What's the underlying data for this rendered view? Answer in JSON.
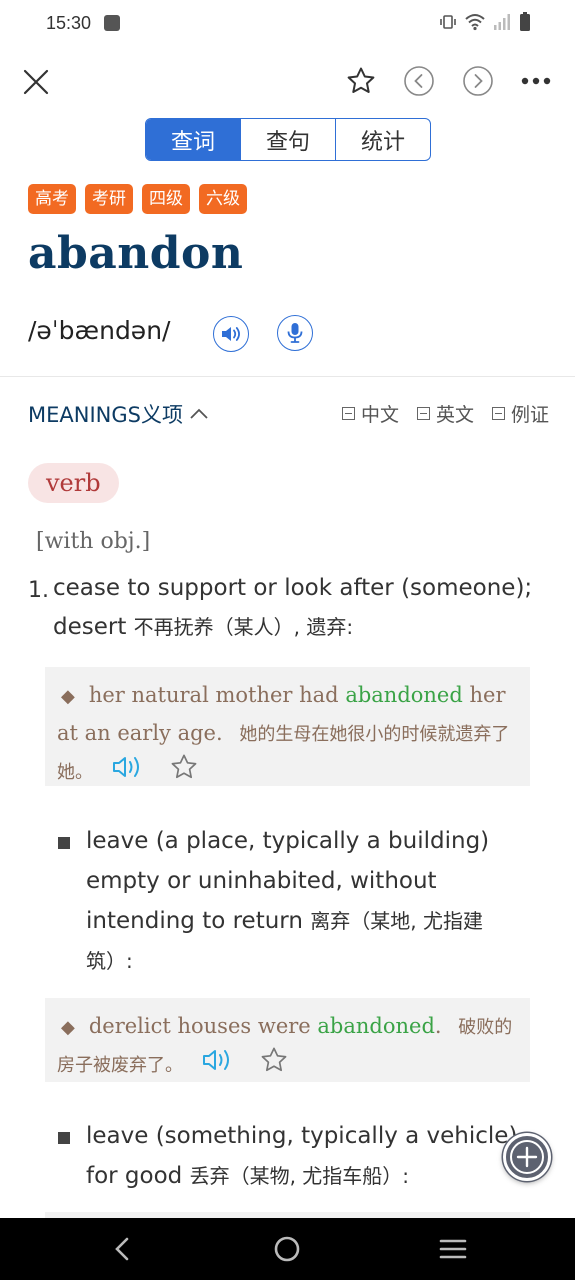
{
  "status_bar": {
    "time": "15:30"
  },
  "tabs": [
    {
      "label": "查词",
      "active": true
    },
    {
      "label": "查句",
      "active": false
    },
    {
      "label": "统计",
      "active": false
    }
  ],
  "tags": [
    "高考",
    "考研",
    "四级",
    "六级"
  ],
  "headword": "abandon",
  "phonetic": "/əˈbændən/",
  "meanings": {
    "label": "MEANINGS义项",
    "filters": [
      "中文",
      "英文",
      "例证"
    ]
  },
  "part_of_speech": "verb",
  "grammar_note": "[with obj.]",
  "sense1": {
    "number": "1.",
    "definition_en": "cease to support or look after (someone); desert",
    "definition_zh": "不再抚养（某人）, 遗弃:",
    "example": {
      "en_before": "her natural mother had",
      "en_highlight": "abandoned",
      "en_after": "her at an early age.",
      "zh": "她的生母在她很小的时候就遗弃了她。"
    }
  },
  "subsense1": {
    "definition_en": "leave (a place, typically a building) empty or uninhabited, without intending to return",
    "definition_zh": "离弃（某地, 尤指建筑）:",
    "example": {
      "en_before": "derelict houses were",
      "en_highlight": "abandoned",
      "en_after": ".",
      "zh": "破败的房子被废弃了。"
    }
  },
  "subsense2": {
    "definition_en": "leave (something, typically a vehicle) for good",
    "definition_zh": "丢弃（某物, 尤指车船）:"
  },
  "colors": {
    "accent": "#2f6fd6",
    "tag": "#f26a22",
    "headword": "#0d3b63",
    "highlight": "#3aa346"
  }
}
